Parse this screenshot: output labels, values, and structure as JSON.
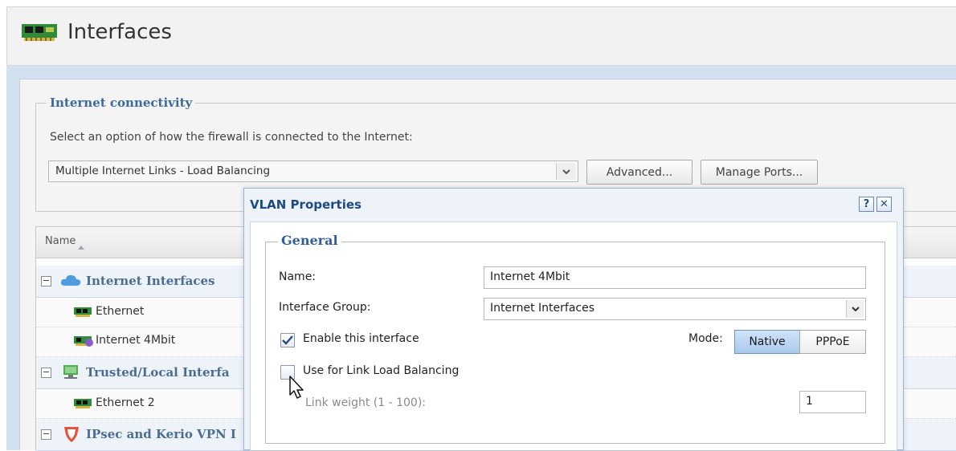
{
  "header": {
    "title": "Interfaces"
  },
  "connectivity": {
    "legend": "Internet connectivity",
    "description": "Select an option of how the firewall is connected to the Internet:",
    "mode_value": "Multiple Internet Links - Load Balancing",
    "advanced_label": "Advanced...",
    "manage_ports_label": "Manage Ports..."
  },
  "grid": {
    "column_name": "Name",
    "groups": [
      {
        "label": "Internet Interfaces",
        "collapse": "−",
        "icon": "cloud-icon",
        "items": [
          {
            "label": "Ethernet",
            "icon": "network-card-icon"
          },
          {
            "label": "Internet 4Mbit",
            "icon": "vlan-card-icon"
          }
        ]
      },
      {
        "label": "Trusted/Local Interfa",
        "collapse": "−",
        "icon": "lan-icon",
        "items": [
          {
            "label": "Ethernet 2",
            "icon": "network-card-icon"
          }
        ]
      },
      {
        "label": "IPsec and Kerio VPN I",
        "collapse": "−",
        "icon": "shield-icon",
        "items": []
      }
    ]
  },
  "dialog": {
    "title": "VLAN Properties",
    "help_label": "?",
    "close_label": "✕",
    "general_legend": "General",
    "name_label": "Name:",
    "name_value": "Internet 4Mbit",
    "group_label": "Interface Group:",
    "group_value": "Internet Interfaces",
    "enable_label": "Enable this interface",
    "enable_checked": true,
    "mode_label": "Mode:",
    "mode_options": [
      "Native",
      "PPPoE"
    ],
    "mode_selected": "Native",
    "lb_label": "Use for Link Load Balancing",
    "lb_checked": false,
    "weight_label": "Link weight (1 - 100):",
    "weight_value": "1"
  },
  "colors": {
    "accent": "#2e5f9a",
    "dialog_title": "#1d4a86",
    "group_label": "#4a6d94",
    "band": "#d2e0f0"
  }
}
